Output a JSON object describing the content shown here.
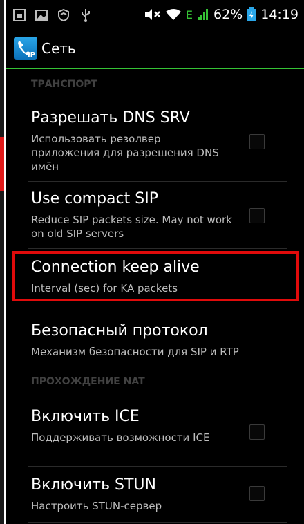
{
  "status_bar": {
    "battery": "62%",
    "time": "14:19",
    "network_type": "E",
    "icons": [
      "image-icon",
      "shield-icon",
      "usb-icon",
      "mute-icon",
      "wifi-icon",
      "signal-icon",
      "battery-icon"
    ]
  },
  "action_bar": {
    "title": "Сеть",
    "icon_label": "IP",
    "accent_color": "#35c235"
  },
  "sections": [
    {
      "header": "ТРАНСПОРТ",
      "items": [
        {
          "title": "Разрешать DNS SRV",
          "summary": "Использовать резолвер приложения для разрешения DNS имён",
          "has_checkbox": true,
          "checked": false
        },
        {
          "title": "Use compact SIP",
          "summary": "Reduce SIP packets size. May not work on old SIP servers",
          "has_checkbox": true,
          "checked": false
        },
        {
          "title": "Connection keep alive",
          "summary": "Interval (sec) for KA packets",
          "has_checkbox": false,
          "highlighted": true
        },
        {
          "title": "Безопасный протокол",
          "summary": "Механизм безопасности для SIP и RTP",
          "has_checkbox": false
        }
      ]
    },
    {
      "header": "ПРОХОЖДЕНИЕ NAT",
      "items": [
        {
          "title": "Включить ICE",
          "summary": "Поддерживать возможности ICE",
          "has_checkbox": true,
          "checked": false
        },
        {
          "title": "Включить STUN",
          "summary": "Настроить STUN-сервер",
          "has_checkbox": true,
          "checked": false
        }
      ]
    }
  ],
  "highlight_color": "#e00b0b"
}
